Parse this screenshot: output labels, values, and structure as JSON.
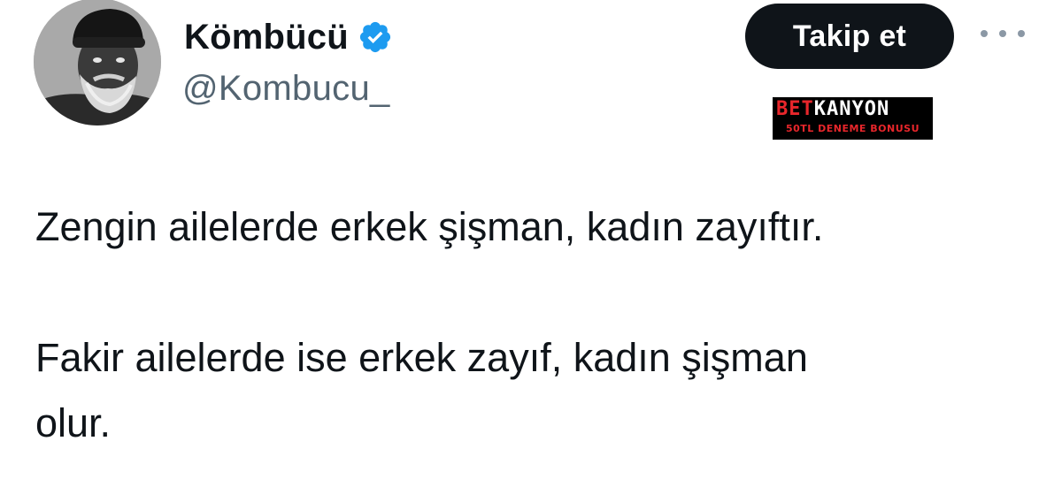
{
  "user": {
    "display_name": "Kömbücü",
    "handle": "@Kombucu_",
    "verified": true,
    "verified_color": "#1d9bf0"
  },
  "actions": {
    "follow_label": "Takip et",
    "more_icon": "more-horizontal-icon"
  },
  "ad_watermark": {
    "brand_part1": "BET",
    "brand_part2": "KANYON",
    "tagline": "50TL DENEME BONUSU",
    "accent_color": "#e8262b"
  },
  "tweet": {
    "paragraph1": "Zengin ailelerde erkek şişman, kadın zayıftır.",
    "paragraph2_line1": "Fakir ailelerde ise erkek zayıf, kadın şişman",
    "paragraph2_line2": "olur."
  }
}
